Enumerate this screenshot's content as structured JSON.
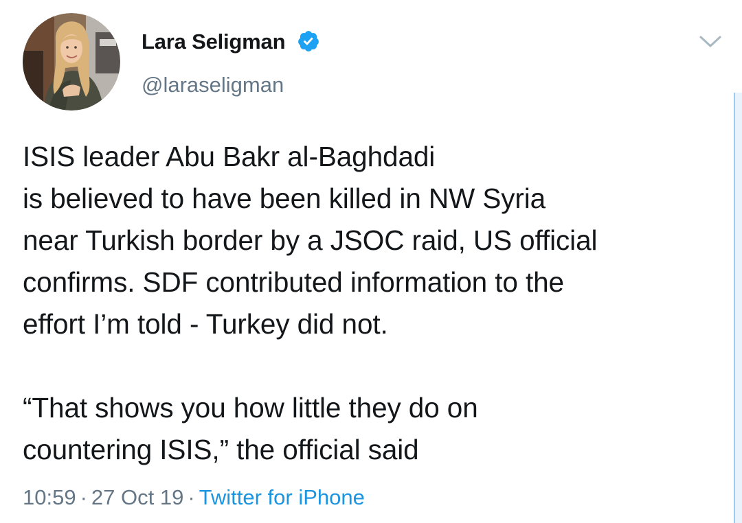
{
  "author": {
    "display_name": "Lara Seligman",
    "handle": "@laraseligman",
    "verified": true,
    "avatar_icon": "profile-photo"
  },
  "tweet": {
    "lines": [
      "ISIS leader Abu Bakr al-Baghdadi",
      "is believed to have been killed in NW Syria",
      "near Turkish border by a JSOC raid, US official",
      "confirms. SDF contributed information to the",
      "effort I’m told - Turkey did not.",
      "",
      "“That shows you how little they do on",
      "countering ISIS,” the official said"
    ]
  },
  "meta": {
    "time": "10:59",
    "separator": "·",
    "date": "27 Oct 19",
    "source": "Twitter for iPhone"
  },
  "icons": {
    "verified": "verified-badge-icon",
    "menu": "chevron-down-icon"
  },
  "colors": {
    "text": "#14171a",
    "secondary": "#657786",
    "link": "#1b95e0",
    "verified": "#1da1f2"
  }
}
